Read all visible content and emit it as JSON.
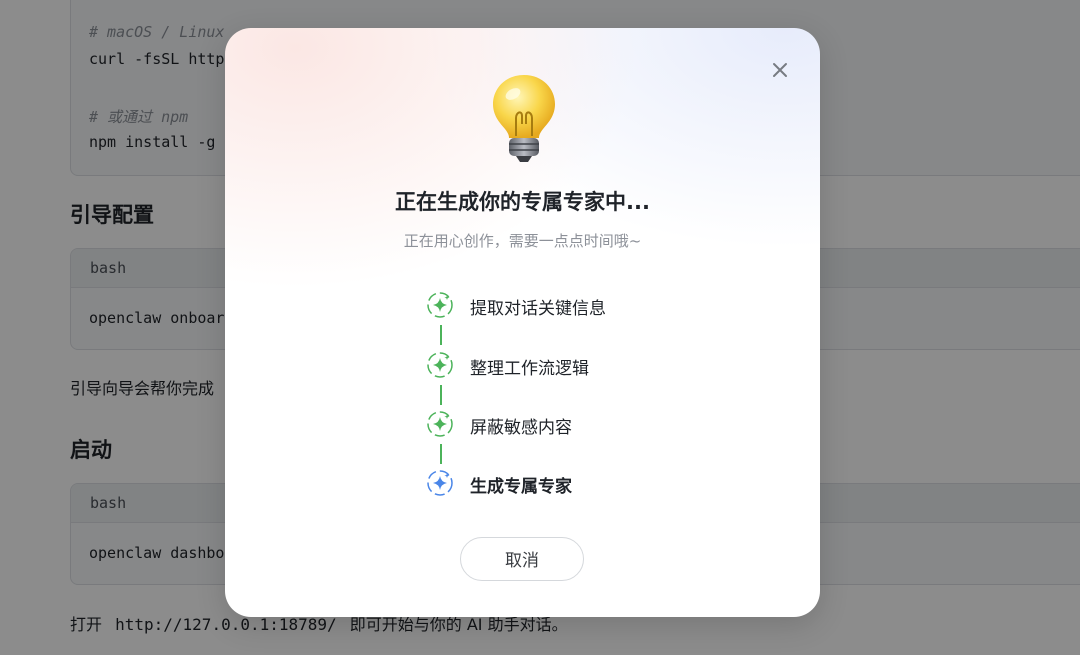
{
  "doc": {
    "install_comment_1": "# macOS / Linux",
    "install_cmd_1": "curl -fsSL https",
    "install_comment_2": "# 或通过 npm",
    "install_cmd_2": "npm install -g c",
    "heading_onboard": "引导配置",
    "lang_1": "bash",
    "onboard_cmd": "openclaw onboard",
    "onboard_desc": "引导向导会帮你完成",
    "heading_start": "启动",
    "lang_2": "bash",
    "start_cmd": "openclaw dashboa",
    "footer_open": "打开",
    "footer_url": "http://127.0.0.1:18789/",
    "footer_tail": "即可开始与你的 AI 助手对话。"
  },
  "modal": {
    "title": "正在生成你的专属专家中...",
    "subtitle": "正在用心创作，需要一点点时间哦~",
    "steps": [
      {
        "label": "提取对话关键信息",
        "status": "done",
        "icon": "sparkle-icon"
      },
      {
        "label": "整理工作流逻辑",
        "status": "done",
        "icon": "sparkle-icon"
      },
      {
        "label": "屏蔽敏感内容",
        "status": "done",
        "icon": "sparkle-icon"
      },
      {
        "label": "生成专属专家",
        "status": "active",
        "icon": "sparkle-icon"
      }
    ],
    "cancel_label": "取消",
    "colors": {
      "done": "#4cb35a",
      "active": "#4a86e8"
    }
  }
}
